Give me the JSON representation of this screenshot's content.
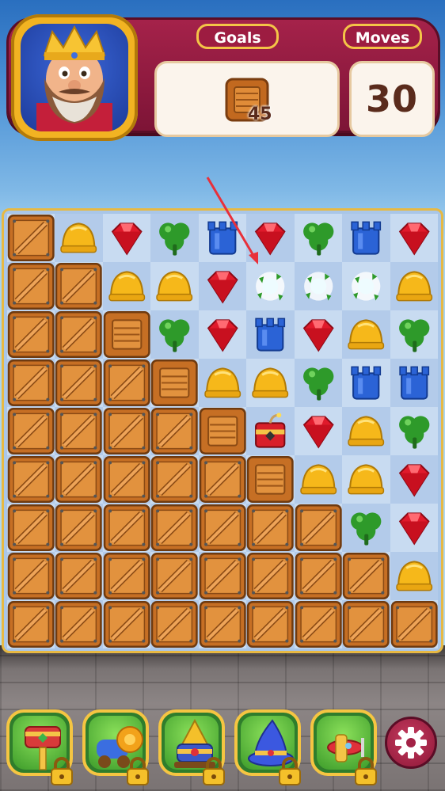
{
  "header": {
    "goals_label": "Goals",
    "moves_label": "Moves",
    "goal_count": "45",
    "moves_value": "30",
    "goal_item_icon": "wooden-crate-icon"
  },
  "board": {
    "rows": 9,
    "cols": 9,
    "cells": [
      [
        "crate",
        "helmet",
        "ruby",
        "clover",
        "tower",
        "ruby",
        "clover",
        "tower",
        "ruby"
      ],
      [
        "crate",
        "crate",
        "helmet",
        "helmet",
        "ruby",
        "sparkle",
        "sparkle",
        "sparkle",
        "helmet"
      ],
      [
        "crate",
        "crate",
        "box",
        "clover",
        "ruby",
        "tower",
        "ruby",
        "helmet",
        "clover"
      ],
      [
        "crate",
        "crate",
        "crate",
        "box",
        "helmet",
        "helmet",
        "clover",
        "tower",
        "tower"
      ],
      [
        "crate",
        "crate",
        "crate",
        "crate",
        "box",
        "dynamite",
        "ruby",
        "helmet",
        "clover"
      ],
      [
        "crate",
        "crate",
        "crate",
        "crate",
        "crate",
        "box",
        "helmet",
        "helmet",
        "ruby"
      ],
      [
        "crate",
        "crate",
        "crate",
        "crate",
        "crate",
        "crate",
        "crate",
        "clover",
        "ruby"
      ],
      [
        "crate",
        "crate",
        "crate",
        "crate",
        "crate",
        "crate",
        "crate",
        "crate",
        "helmet"
      ],
      [
        "crate",
        "crate",
        "crate",
        "crate",
        "crate",
        "crate",
        "crate",
        "crate",
        "crate"
      ]
    ]
  },
  "boosters": [
    {
      "icon": "hammer-icon",
      "locked": true
    },
    {
      "icon": "cannon-icon",
      "locked": true
    },
    {
      "icon": "drill-cannon-icon",
      "locked": true
    },
    {
      "icon": "wizard-hat-icon",
      "locked": true
    },
    {
      "icon": "airplane-icon",
      "locked": true
    }
  ],
  "settings_icon": "gear-icon",
  "colors": {
    "header": "#9d1c41",
    "gold": "#f4c447",
    "crate": "#c9792e",
    "ruby": "#e01a2b",
    "clover": "#2e9a2a",
    "tower": "#2b63d6",
    "helmet": "#f6b81a"
  }
}
